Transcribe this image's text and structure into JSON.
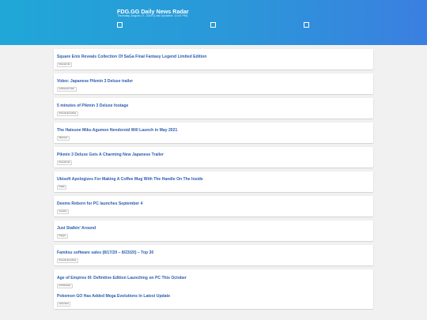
{
  "header": {
    "title": "FDG.GG Daily News Radar",
    "subtitle": "Thursday, August 27, 2020 (Last Updated: 11:44 PM)"
  },
  "articles": [
    {
      "title": "Square Enix Reveals Collection Of SaGa Final Fantasy Legend Limited Edition",
      "source": "Nintendo Life"
    },
    {
      "title": "Video: Japanese Pikmin 3 Deluxe trailer",
      "source": "GoNintendo Video"
    },
    {
      "title": "5 minutes of Pikmin 3 Deluxe footage",
      "source": "Nintendo Everything"
    },
    {
      "title": "The Hatsune Miku Agumon Nendoroid Will Launch in May 2021",
      "source": "Siliconera"
    },
    {
      "title": "Pikmin 3 Deluxe Gets A Charming New Japanese Trailer",
      "source": "Nintendo Life"
    },
    {
      "title": "Ubisoft Apologizes For Making A Coffee Mug With The Handle On The Inside",
      "source": "Kotaku"
    },
    {
      "title": "Deemo Reborn for PC launches September 4",
      "source": "Gematsu"
    },
    {
      "title": "Just Stalkin' Around",
      "source": "Polygon"
    },
    {
      "title": "Famitsu software sales (8/17/20 – 8/23/20) – Top 30",
      "source": "Nintendo Everything"
    },
    {
      "title": "Age of Empires III: Definitive Edition Launching on PC This October",
      "source": "IGN Windows"
    },
    {
      "title": "Pokemon GO Has Added Mega Evolutions In Latest Update",
      "source": "Game Rant"
    }
  ]
}
